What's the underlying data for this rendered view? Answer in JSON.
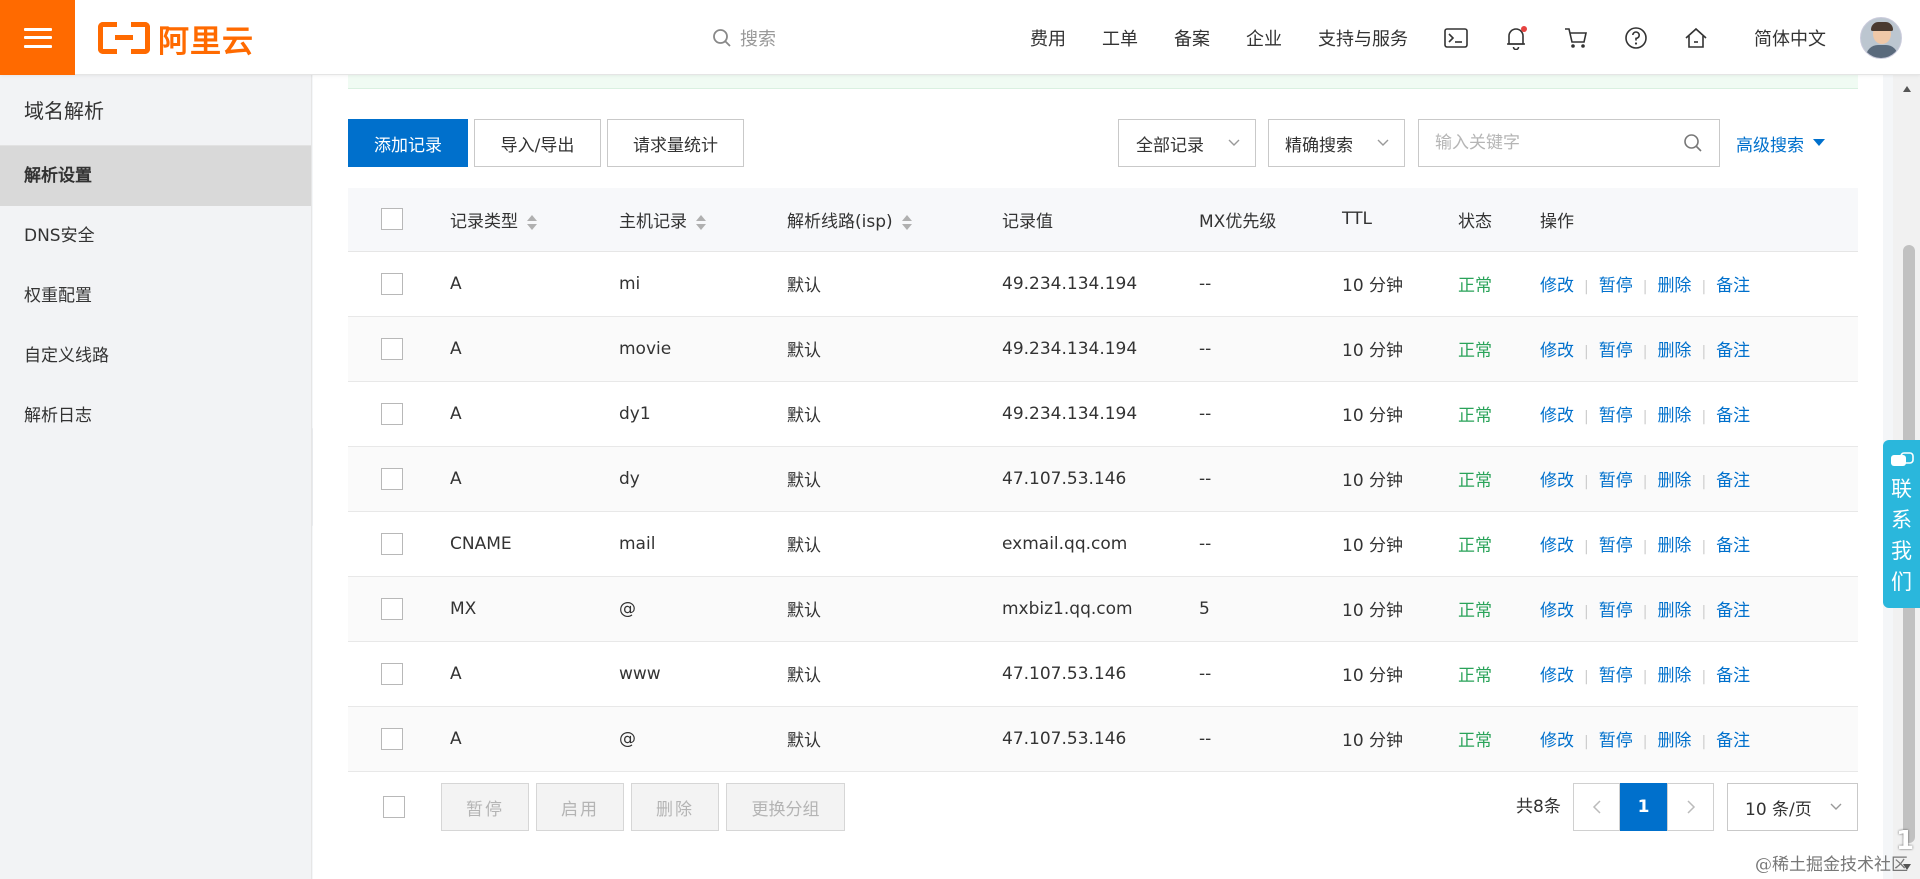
{
  "topbar": {
    "logo_text": "阿里云",
    "search_placeholder": "搜索",
    "nav": [
      "费用",
      "工单",
      "备案",
      "企业",
      "支持与服务"
    ],
    "icons": [
      "terminal-icon",
      "bell-icon",
      "cart-icon",
      "help-icon",
      "home-icon"
    ],
    "language": "简体中文"
  },
  "sidebar": {
    "title": "域名解析",
    "items": [
      "解析设置",
      "DNS安全",
      "权重配置",
      "自定义线路",
      "解析日志"
    ],
    "active_index": 0
  },
  "toolbar": {
    "add_record": "添加记录",
    "import_export": "导入/导出",
    "request_stats": "请求量统计",
    "record_filter": "全部记录",
    "search_mode": "精确搜索",
    "keyword_placeholder": "输入关键字",
    "advanced_search": "高级搜索"
  },
  "table": {
    "headers": [
      "记录类型",
      "主机记录",
      "解析线路(isp)",
      "记录值",
      "MX优先级",
      "TTL",
      "状态",
      "操作"
    ],
    "rows": [
      {
        "type": "A",
        "host": "mi",
        "line": "默认",
        "value": "49.234.134.194",
        "mx": "--",
        "ttl": "10 分钟",
        "status": "正常"
      },
      {
        "type": "A",
        "host": "movie",
        "line": "默认",
        "value": "49.234.134.194",
        "mx": "--",
        "ttl": "10 分钟",
        "status": "正常"
      },
      {
        "type": "A",
        "host": "dy1",
        "line": "默认",
        "value": "49.234.134.194",
        "mx": "--",
        "ttl": "10 分钟",
        "status": "正常"
      },
      {
        "type": "A",
        "host": "dy",
        "line": "默认",
        "value": "47.107.53.146",
        "mx": "--",
        "ttl": "10 分钟",
        "status": "正常"
      },
      {
        "type": "CNAME",
        "host": "mail",
        "line": "默认",
        "value": "exmail.qq.com",
        "mx": "--",
        "ttl": "10 分钟",
        "status": "正常"
      },
      {
        "type": "MX",
        "host": "@",
        "line": "默认",
        "value": "mxbiz1.qq.com",
        "mx": "5",
        "ttl": "10 分钟",
        "status": "正常"
      },
      {
        "type": "A",
        "host": "www",
        "line": "默认",
        "value": "47.107.53.146",
        "mx": "--",
        "ttl": "10 分钟",
        "status": "正常"
      },
      {
        "type": "A",
        "host": "@",
        "line": "默认",
        "value": "47.107.53.146",
        "mx": "--",
        "ttl": "10 分钟",
        "status": "正常"
      }
    ],
    "actions": [
      "修改",
      "暂停",
      "删除",
      "备注"
    ]
  },
  "bottom": {
    "bulk_pause": "暂停",
    "bulk_enable": "启用",
    "bulk_delete": "删除",
    "change_group": "更换分组",
    "total": "共8条",
    "current_page": "1",
    "page_size": "10 条/页"
  },
  "float": {
    "contact": [
      "联",
      "系",
      "我",
      "们"
    ],
    "watermark": "@稀土掘金技术社区",
    "corner_num": "1"
  },
  "colors": {
    "brand_orange": "#ff6a00",
    "primary_blue": "#0070cc",
    "status_green": "#2aa35a",
    "contact_cyan": "#2ab7dc"
  }
}
